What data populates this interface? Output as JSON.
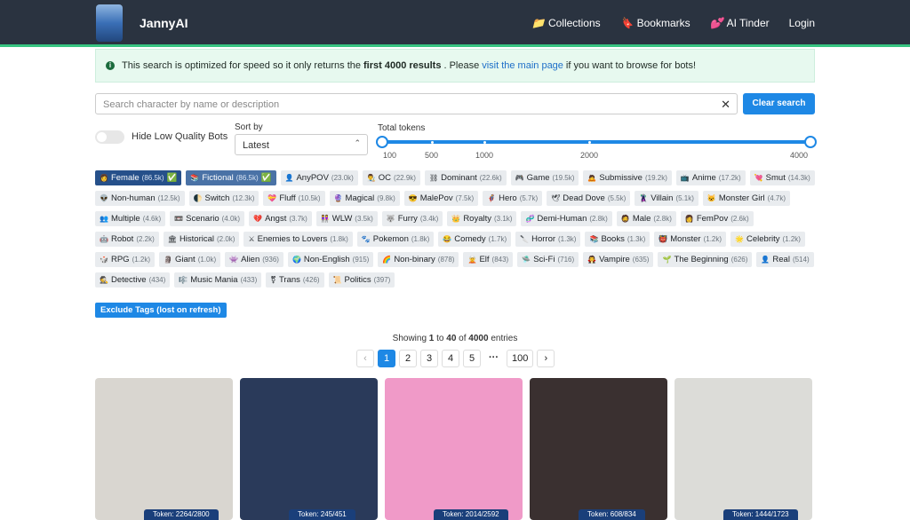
{
  "nav": {
    "brand": "JannyAI",
    "links": [
      {
        "icon": "📁",
        "label": "Collections"
      },
      {
        "icon": "🔖",
        "label": "Bookmarks"
      },
      {
        "icon": "💕",
        "label": "AI Tinder"
      },
      {
        "icon": "",
        "label": "Login"
      }
    ]
  },
  "alert": {
    "pre": "This search is optimized for speed so it only returns the",
    "bold": "first 4000 results",
    "mid": ". Please",
    "link": "visit the main page",
    "post": "if you want to browse for bots!"
  },
  "search": {
    "placeholder": "Search character by name or description",
    "clear_label": "Clear search"
  },
  "filters": {
    "hide_low_quality_label": "Hide Low Quality Bots",
    "sort_label": "Sort by",
    "sort_value": "Latest",
    "tokens_label": "Total tokens",
    "tokens_min": 100,
    "tokens_max": 4000,
    "tick_labels": [
      "100",
      "500",
      "1000",
      "2000",
      "4000"
    ]
  },
  "tags": [
    {
      "e": "👩",
      "n": "Female",
      "c": "(86.5k)",
      "s": "✅",
      "st": "sel"
    },
    {
      "e": "📚",
      "n": "Fictional",
      "c": "(86.5k)",
      "s": "✅",
      "st": "sel2"
    },
    {
      "e": "👤",
      "n": "AnyPOV",
      "c": "(23.0k)"
    },
    {
      "e": "👨‍🎨",
      "n": "OC",
      "c": "(22.9k)"
    },
    {
      "e": "⛓",
      "n": "Dominant",
      "c": "(22.6k)"
    },
    {
      "e": "🎮",
      "n": "Game",
      "c": "(19.5k)"
    },
    {
      "e": "🙇",
      "n": "Submissive",
      "c": "(19.2k)"
    },
    {
      "e": "📺",
      "n": "Anime",
      "c": "(17.2k)"
    },
    {
      "e": "💘",
      "n": "Smut",
      "c": "(14.3k)"
    },
    {
      "e": "👽",
      "n": "Non-human",
      "c": "(12.5k)"
    },
    {
      "e": "🌓",
      "n": "Switch",
      "c": "(12.3k)"
    },
    {
      "e": "💝",
      "n": "Fluff",
      "c": "(10.5k)"
    },
    {
      "e": "🔮",
      "n": "Magical",
      "c": "(9.8k)"
    },
    {
      "e": "😎",
      "n": "MalePov",
      "c": "(7.5k)"
    },
    {
      "e": "🦸",
      "n": "Hero",
      "c": "(5.7k)"
    },
    {
      "e": "🕊",
      "n": "Dead Dove",
      "c": "(5.5k)"
    },
    {
      "e": "🦹",
      "n": "Villain",
      "c": "(5.1k)"
    },
    {
      "e": "😺",
      "n": "Monster Girl",
      "c": "(4.7k)"
    },
    {
      "e": "👥",
      "n": "Multiple",
      "c": "(4.6k)"
    },
    {
      "e": "📼",
      "n": "Scenario",
      "c": "(4.0k)"
    },
    {
      "e": "💔",
      "n": "Angst",
      "c": "(3.7k)"
    },
    {
      "e": "👭",
      "n": "WLW",
      "c": "(3.5k)"
    },
    {
      "e": "🐺",
      "n": "Furry",
      "c": "(3.4k)"
    },
    {
      "e": "👑",
      "n": "Royalty",
      "c": "(3.1k)"
    },
    {
      "e": "🧬",
      "n": "Demi-Human",
      "c": "(2.8k)"
    },
    {
      "e": "🧔",
      "n": "Male",
      "c": "(2.8k)"
    },
    {
      "e": "👩",
      "n": "FemPov",
      "c": "(2.6k)"
    },
    {
      "e": "🤖",
      "n": "Robot",
      "c": "(2.2k)"
    },
    {
      "e": "🏛",
      "n": "Historical",
      "c": "(2.0k)"
    },
    {
      "e": "⚔",
      "n": "Enemies to Lovers",
      "c": "(1.8k)"
    },
    {
      "e": "🐾",
      "n": "Pokemon",
      "c": "(1.8k)"
    },
    {
      "e": "😂",
      "n": "Comedy",
      "c": "(1.7k)"
    },
    {
      "e": "🔪",
      "n": "Horror",
      "c": "(1.3k)"
    },
    {
      "e": "📚",
      "n": "Books",
      "c": "(1.3k)"
    },
    {
      "e": "👹",
      "n": "Monster",
      "c": "(1.2k)"
    },
    {
      "e": "🌟",
      "n": "Celebrity",
      "c": "(1.2k)"
    },
    {
      "e": "🎲",
      "n": "RPG",
      "c": "(1.2k)"
    },
    {
      "e": "🗿",
      "n": "Giant",
      "c": "(1.0k)"
    },
    {
      "e": "👾",
      "n": "Alien",
      "c": "(936)"
    },
    {
      "e": "🌍",
      "n": "Non-English",
      "c": "(915)"
    },
    {
      "e": "🌈",
      "n": "Non-binary",
      "c": "(878)"
    },
    {
      "e": "🧝",
      "n": "Elf",
      "c": "(843)"
    },
    {
      "e": "🛸",
      "n": "Sci-Fi",
      "c": "(716)"
    },
    {
      "e": "🧛",
      "n": "Vampire",
      "c": "(635)"
    },
    {
      "e": "🌱",
      "n": "The Beginning",
      "c": "(626)"
    },
    {
      "e": "👤",
      "n": "Real",
      "c": "(514)"
    },
    {
      "e": "🕵",
      "n": "Detective",
      "c": "(434)"
    },
    {
      "e": "🎼",
      "n": "Music Mania",
      "c": "(433)"
    },
    {
      "e": "⚧",
      "n": "Trans",
      "c": "(426)"
    },
    {
      "e": "📜",
      "n": "Politics",
      "c": "(397)"
    }
  ],
  "exclude_label": "Exclude Tags (lost on refresh)",
  "showing": {
    "pre": "Showing",
    "from": "1",
    "to_word": "to",
    "to": "40",
    "of_word": "of",
    "total": "4000",
    "post": "entries"
  },
  "pagination": [
    "‹",
    "1",
    "2",
    "3",
    "4",
    "5",
    "···",
    "100",
    "›"
  ],
  "cards": [
    {
      "tokens": "Token: 2264/2800",
      "bg": "#d9d6d0"
    },
    {
      "tokens": "Token: 245/451",
      "bg": "#2a3a5a"
    },
    {
      "tokens": "Token: 2014/2592",
      "bg": "#f09ac8"
    },
    {
      "tokens": "Token: 608/834",
      "bg": "#3a3030"
    },
    {
      "tokens": "Token: 1444/1723",
      "bg": "#dcdcd8"
    }
  ]
}
